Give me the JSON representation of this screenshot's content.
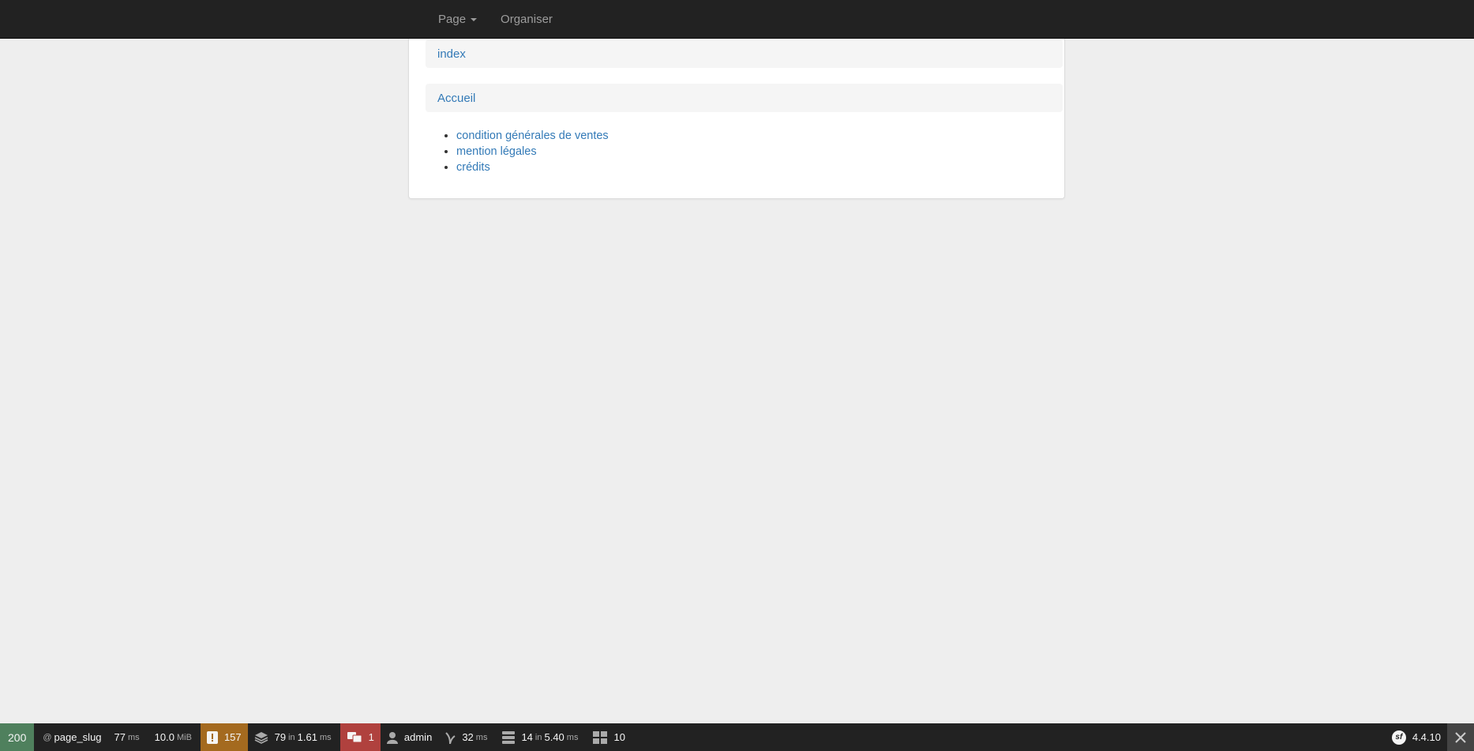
{
  "navbar": {
    "items": [
      {
        "label": "Page",
        "dropdown": true
      },
      {
        "label": "Organiser",
        "dropdown": false
      }
    ]
  },
  "panel": {
    "crumb_index": "index",
    "crumb_home": "Accueil",
    "links": [
      "condition générales de ventes",
      "mention légales",
      "crédits"
    ]
  },
  "toolbar": {
    "status": "200",
    "route_prefix": "@",
    "route": "page_slug",
    "time_value": "77",
    "time_unit": "ms",
    "memory_value": "10.0",
    "memory_unit": "MiB",
    "logs_count": "157",
    "cache_value": "79",
    "cache_in": "in",
    "cache_time": "1.61",
    "cache_unit": "ms",
    "translation_count": "1",
    "user": "admin",
    "twig_value": "32",
    "twig_unit": "ms",
    "db_value": "14",
    "db_in": "in",
    "db_time": "5.40",
    "db_unit": "ms",
    "forms_count": "10",
    "version": "4.4.10",
    "logo_text": "sf",
    "colors": {
      "status": "#4f805d",
      "warning": "#a46a1f",
      "error": "#b0413e"
    }
  }
}
